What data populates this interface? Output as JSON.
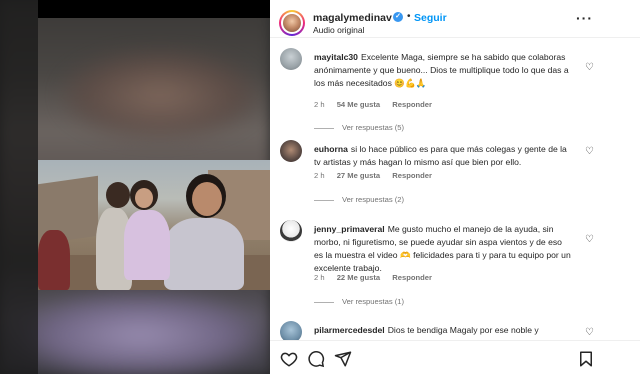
{
  "post": {
    "username": "magalymedinav",
    "follow_label": "Seguir",
    "audio": "Audio original",
    "separator": "•"
  },
  "comments": [
    {
      "username": "mayitalc30",
      "text": "Excelente Maga, siempre se ha sabido que colaboras anónimamente y que bueno... Dios te multiplique todo lo que das a los más necesitados 😊💪🙏",
      "time": "2 h",
      "likes": "54 Me gusta",
      "reply_label": "Responder",
      "view_replies": "Ver respuestas (5)",
      "avatar_color": "#9aa3a8"
    },
    {
      "username": "euhorna",
      "text": "si lo hace público es para que más colegas y gente de la tv artistas y más hagan lo mismo así que bien por ello.",
      "time": "2 h",
      "likes": "27 Me gusta",
      "reply_label": "Responder",
      "view_replies": "Ver respuestas (2)",
      "avatar_color": "#5a4a44"
    },
    {
      "username": "jenny_primaveral",
      "text": "Me gusto mucho el manejo de la ayuda, sin morbo, ni figuretismo, se puede ayudar sin aspa vientos y de eso es la muestra el video 🫶 felicidades para ti y para tu equipo por un excelente trabajo.",
      "time": "2 h",
      "likes": "22 Me gusta",
      "reply_label": "Responder",
      "view_replies": "Ver respuestas (1)",
      "avatar_color": "#e9e9e9"
    },
    {
      "username": "pilarmercedesdel",
      "text": "Dios te bendiga Magaly por ese noble y",
      "avatar_color": "#6e8fa8"
    }
  ],
  "actions": [
    "heart-icon",
    "comment-icon",
    "share-icon",
    "bookmark-icon"
  ],
  "colors": {
    "accent": "#0095f6",
    "verified": "#3897f0",
    "text": "#262626",
    "muted": "#737373"
  }
}
